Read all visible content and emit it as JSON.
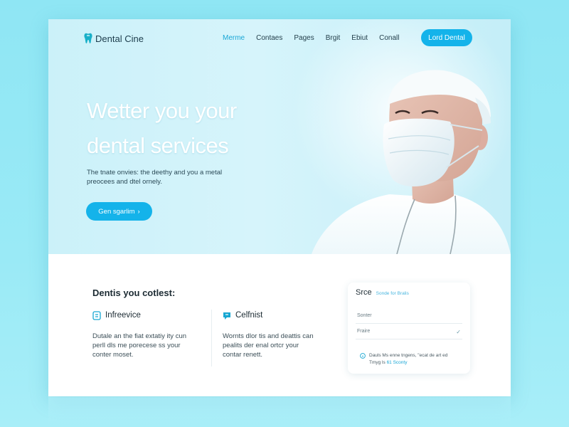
{
  "nav": {
    "logo_text": "Dental Cine",
    "links": [
      "Merme",
      "Contaes",
      "Pages",
      "Brgit",
      "Ebiut",
      "Conall"
    ],
    "cta_label": "Lord Dental"
  },
  "hero": {
    "title_line1": "Wetter you your",
    "title_line2": "dental services",
    "subtitle_line1": "The tnate onvies: the deethy and you a metal",
    "subtitle_line2": "preocees and dtel ornely.",
    "button_label": "Gen sgarlim",
    "button_icon": "chevron-right-icon"
  },
  "features_section": {
    "title": "Dentis you cotlest:",
    "items": [
      {
        "name": "Infreevice",
        "icon": "tooth-icon",
        "text_line1": "Dutale an the fiat extatiy ity cun",
        "text_line2": "perll dls me porecese ss your",
        "text_line3": "conter moset."
      },
      {
        "name": "Celfnist",
        "icon": "chat-tooth-icon",
        "text_line1": "Wornts dlor tis and deattis can",
        "text_line2": "pealits der enal ortcr your",
        "text_line3": "contar renett."
      }
    ]
  },
  "form": {
    "title": "Srce",
    "title_sub": "Sonde for Bralis",
    "field1_placeholder": "Sonter",
    "field2_placeholder": "Fraire",
    "note_text": "Dauls Ms enne tngens, \"ecat de art ed",
    "note_text2": "Tmyg ls",
    "note_link": "61 Sconty",
    "accent": "#14b3ea"
  }
}
